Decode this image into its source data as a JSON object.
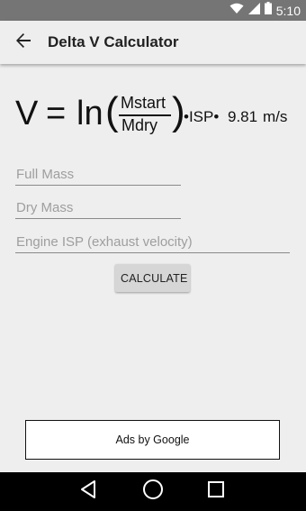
{
  "status_bar": {
    "time": "5:10",
    "icons": [
      "wifi-icon",
      "signal-icon",
      "battery-icon"
    ]
  },
  "toolbar": {
    "back_icon": "arrow-left-icon",
    "title": "Delta V Calculator"
  },
  "formula": {
    "lhs": "V",
    "equals": "=",
    "ln": "ln",
    "open_paren": "(",
    "numerator": "Mstart",
    "denominator": "Mdry",
    "close_paren": ")",
    "tail_isp": "•ISP•",
    "tail_value": "9.81",
    "tail_unit": "m/s"
  },
  "inputs": {
    "full_mass": {
      "placeholder": "Full Mass",
      "value": ""
    },
    "dry_mass": {
      "placeholder": "Dry Mass",
      "value": ""
    },
    "engine_isp": {
      "placeholder": "Engine ISP (exhaust velocity)",
      "value": ""
    }
  },
  "calculate_label": "CALCULATE",
  "ads_label": "Ads by Google",
  "nav": {
    "back": "back-triangle-icon",
    "home": "home-circle-icon",
    "recents": "recents-square-icon"
  },
  "colors": {
    "status_bar": "#757575",
    "background": "#eeeeee",
    "button": "#d6d6d6",
    "nav_bar": "#000000"
  }
}
